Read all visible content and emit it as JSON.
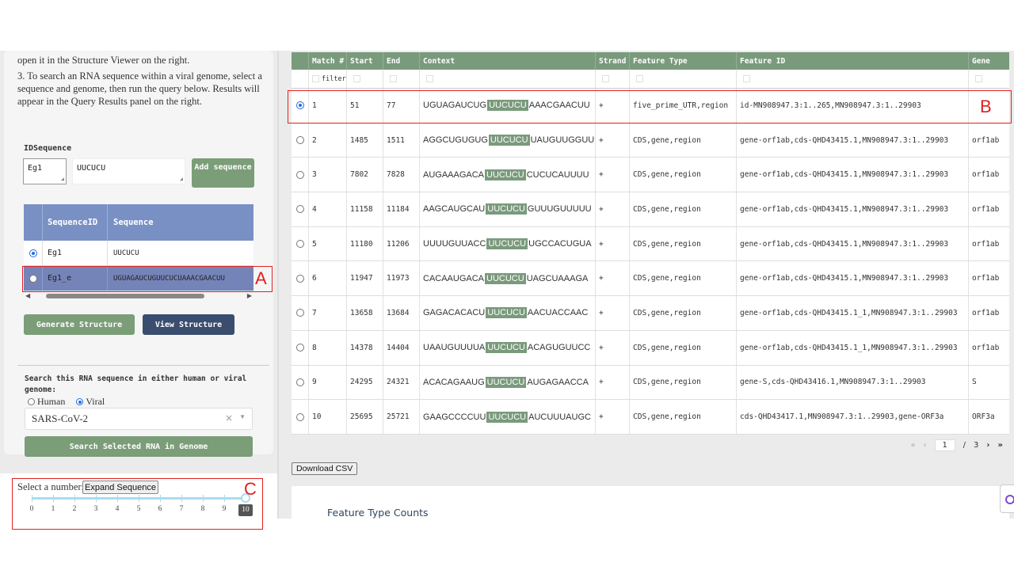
{
  "instructions": {
    "cut_line": "",
    "line1": "open it in the Structure Viewer on the right.",
    "line2": "3. To search an RNA sequence within a viral genome, select a sequence and genome, then run the query below. Results will appear in the Query Results panel on the right."
  },
  "input_section": {
    "label": "IDSequence",
    "id_value": "Eg1",
    "sequence_value": "UUCUCU",
    "add_button": "Add sequence"
  },
  "sequence_table": {
    "headers": [
      "SequenceID",
      "Sequence"
    ],
    "rows": [
      {
        "id": "Eg1",
        "sequence": "UUCUCU",
        "selected": true
      },
      {
        "id": "Eg1_e",
        "sequence": "UGUAGAUCUGUUCUCUAAACGAACUU",
        "selected": false
      }
    ]
  },
  "buttons": {
    "generate": "Generate Structure",
    "view": "View Structure",
    "search": "Search Selected RNA in Genome",
    "expand": "Expand Sequence",
    "download": "Download CSV"
  },
  "genome_search": {
    "label": "Search this RNA sequence in either human or viral genome:",
    "option_human": "Human",
    "option_viral": "Viral",
    "selected_option": "Viral",
    "selected_genome": "SARS-CoV-2",
    "clear_glyph": "×"
  },
  "slider": {
    "label": "Select a number:",
    "ticks": [
      "0",
      "1",
      "2",
      "3",
      "4",
      "5",
      "6",
      "7",
      "8",
      "9",
      "10"
    ],
    "value": 10
  },
  "results": {
    "headers": [
      "Match #",
      "Start",
      "End",
      "Context",
      "Strand",
      "Feature Type",
      "Feature ID",
      "Gene"
    ],
    "filter_placeholder": "filter",
    "rows": [
      {
        "match": "1",
        "start": "51",
        "end": "77",
        "pre": "UGUAGAUCUG",
        "hit": "UUCUCU",
        "post": "AAACGAACUU",
        "strand": "+",
        "ftype": "five_prime_UTR,region",
        "fid": "id-MN908947.3:1..265,MN908947.3:1..29903",
        "gene": "",
        "selected": true
      },
      {
        "match": "2",
        "start": "1485",
        "end": "1511",
        "pre": "AGGCUGUGUG",
        "hit": "UUCUCU",
        "post": "UAUGUUGGUU",
        "strand": "+",
        "ftype": "CDS,gene,region",
        "fid": "gene-orf1ab,cds-QHD43415.1,MN908947.3:1..29903",
        "gene": "orf1ab",
        "selected": false
      },
      {
        "match": "3",
        "start": "7802",
        "end": "7828",
        "pre": "AUGAAAGACA",
        "hit": "UUCUCU",
        "post": "CUCUCAUUUU",
        "strand": "+",
        "ftype": "CDS,gene,region",
        "fid": "gene-orf1ab,cds-QHD43415.1,MN908947.3:1..29903",
        "gene": "orf1ab",
        "selected": false
      },
      {
        "match": "4",
        "start": "11158",
        "end": "11184",
        "pre": "AAGCAUGCAU",
        "hit": "UUCUCU",
        "post": "GUUUGUUUUU",
        "strand": "+",
        "ftype": "CDS,gene,region",
        "fid": "gene-orf1ab,cds-QHD43415.1,MN908947.3:1..29903",
        "gene": "orf1ab",
        "selected": false
      },
      {
        "match": "5",
        "start": "11180",
        "end": "11206",
        "pre": "UUUUGUUACC",
        "hit": "UUCUCU",
        "post": "UGCCACUGUA",
        "strand": "+",
        "ftype": "CDS,gene,region",
        "fid": "gene-orf1ab,cds-QHD43415.1,MN908947.3:1..29903",
        "gene": "orf1ab",
        "selected": false
      },
      {
        "match": "6",
        "start": "11947",
        "end": "11973",
        "pre": "CACAAUGACA",
        "hit": "UUCUCU",
        "post": "UAGCUAAAGA",
        "strand": "+",
        "ftype": "CDS,gene,region",
        "fid": "gene-orf1ab,cds-QHD43415.1,MN908947.3:1..29903",
        "gene": "orf1ab",
        "selected": false
      },
      {
        "match": "7",
        "start": "13658",
        "end": "13684",
        "pre": "GAGACACACU",
        "hit": "UUCUCU",
        "post": "AACUACCAAC",
        "strand": "+",
        "ftype": "CDS,gene,region",
        "fid": "gene-orf1ab,cds-QHD43415.1_1,MN908947.3:1..29903",
        "gene": "orf1ab",
        "selected": false
      },
      {
        "match": "8",
        "start": "14378",
        "end": "14404",
        "pre": "UAAUGUUUUA",
        "hit": "UUCUCU",
        "post": "ACAGUGUUCC",
        "strand": "+",
        "ftype": "CDS,gene,region",
        "fid": "gene-orf1ab,cds-QHD43415.1_1,MN908947.3:1..29903",
        "gene": "orf1ab",
        "selected": false
      },
      {
        "match": "9",
        "start": "24295",
        "end": "24321",
        "pre": "ACACAGAAUG",
        "hit": "UUCUCU",
        "post": "AUGAGAACCA",
        "strand": "+",
        "ftype": "CDS,gene,region",
        "fid": "gene-S,cds-QHD43416.1,MN908947.3:1..29903",
        "gene": "S",
        "selected": false
      },
      {
        "match": "10",
        "start": "25695",
        "end": "25721",
        "pre": "GAAGCCCCUU",
        "hit": "UUCUCU",
        "post": "AUCUUUAUGC",
        "strand": "+",
        "ftype": "CDS,gene,region",
        "fid": "cds-QHD43417.1,MN908947.3:1..29903,gene-ORF3a",
        "gene": "ORF3a",
        "selected": false
      }
    ]
  },
  "pager": {
    "first": "«",
    "prev": "‹",
    "current": "1",
    "separator": "/",
    "total": "3",
    "next": "›",
    "last": "»"
  },
  "feature_counts": {
    "title": "Feature Type Counts"
  },
  "annotations": {
    "a": "A",
    "b": "B",
    "c": "C",
    "color": "#e02020"
  },
  "colors": {
    "accent_green": "#7b9d78",
    "header_blue": "#7990c4",
    "dark_navy": "#3a4d6e"
  }
}
